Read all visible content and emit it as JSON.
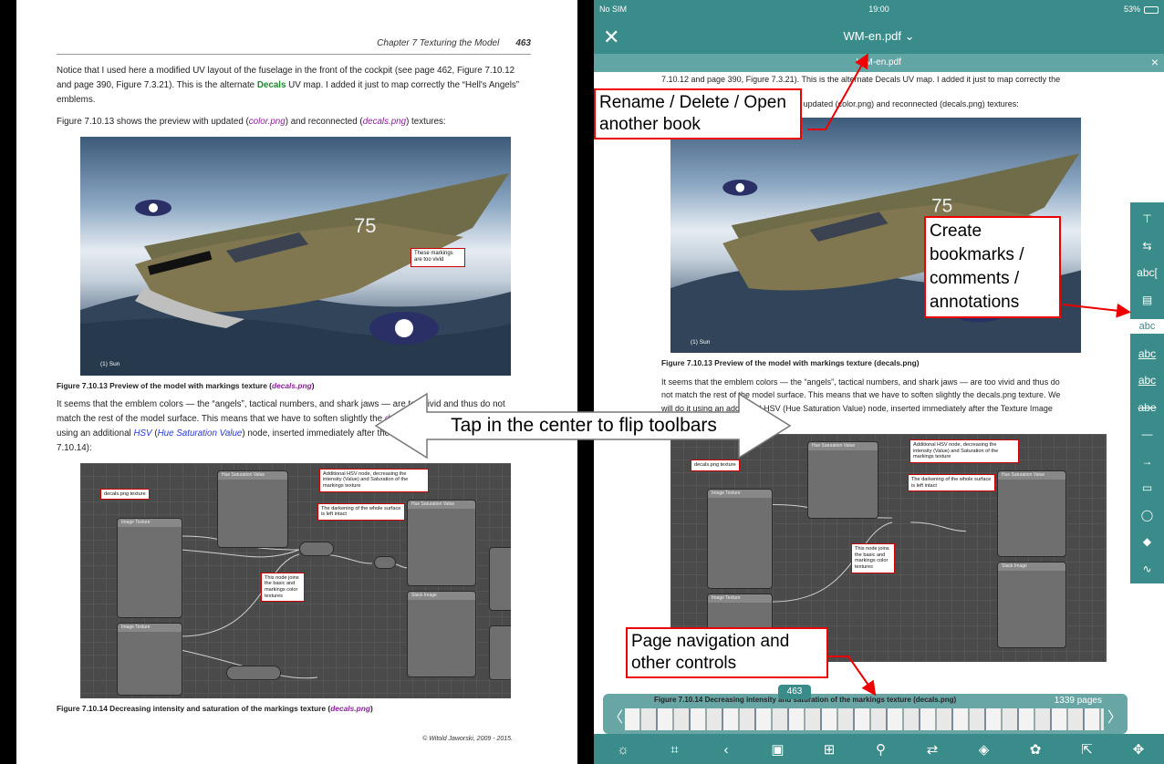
{
  "left_page": {
    "chapter": "Chapter 7 Texturing the Model",
    "page_number": "463",
    "para1_a": "Notice that I used here a modified UV layout of the fuselage in the front of the cockpit (see page 462, Figure 7.10.12 and page 390, Figure 7.3.21). This is the alternate ",
    "para1_decals": "Decals",
    "para1_b": " UV map. I added it just to map correctly the “Hell's Angels” emblems.",
    "para2_a": "Figure 7.10.13 shows the preview with updated (",
    "para2_color": "color.png",
    "para2_b": ") and reconnected (",
    "para2_decals": "decals.png",
    "para2_c": ") textures:",
    "photo_note": "These markings are too vivid",
    "sun_label": "(1) Sun",
    "caption1_a": "Figure 7.10.13 Preview of the model with markings texture (",
    "caption1_file": "decals.png",
    "caption1_b": ")",
    "para3_a": "It seems that the emblem colors — the “angels”, tactical numbers, and shark jaws — are too vivid and thus do not match the rest of the model surface. This means that we have to soften slightly the ",
    "para3_file": "decals.png",
    "para3_b": " texture. We will do it using an additional ",
    "para3_hsv": "HSV",
    "para3_c": " (",
    "para3_hsvfull": "Hue Saturation Value",
    "para3_d": ") node, inserted immediately after the ",
    "para3_tex": "Texture Image",
    "para3_e": " node (Figure 7.10.14):",
    "caption2_a": "Figure 7.10.14 Decreasing intensity and saturation of the markings texture (",
    "caption2_file": "decals.png",
    "caption2_b": ")",
    "footer": "© Witold Jaworski, 2009 - 2015."
  },
  "node_labels": {
    "decals_texture": "decals.png texture",
    "hsv_note": "Additional HSV node, decreasing the intensity (Value) and Saturation of the markings texture",
    "darkening_note": "The darkening of the whole surface is left intact",
    "joins_note": "This node joins the basic and markings color textures"
  },
  "ipad": {
    "carrier": "No SIM",
    "time": "19:00",
    "battery": "53%",
    "doc_title": "WM-en.pdf ⌄",
    "tab_title": "WM-en.pdf",
    "text_top": "7.10.12 and page 390, Figure 7.3.21). This is the alternate Decals UV map. I added it just to map correctly the",
    "text_preview": "Figure 7.10.13 shows the preview with updated (color.png) and reconnected (decals.png) textures:",
    "caption1": "Figure 7.10.13 Preview of the model with markings texture (decals.png)",
    "text_lines": [
      "It seems that the emblem colors — the “angels”, tactical numbers, and shark jaws — are too vivid and thus do",
      "not match the rest of the model surface. This means that we have to soften slightly the decals.png texture. We",
      "will do it using an additional HSV (Hue Saturation Value) node, inserted immediately after the Texture Image",
      "node (Figure 7.10.14):"
    ],
    "caption2": "Figure 7.10.14 Decreasing intensity and saturation of the markings texture (decals.png)",
    "current_page": "463",
    "page_count": "1339 pages",
    "sidebar_icons": [
      "pin-icon",
      "pages-icon",
      "text-select-icon",
      "comment-icon",
      "highlight-icon",
      "underline-icon",
      "squiggly-icon",
      "strikeout-icon",
      "line-icon",
      "arrow-icon",
      "rectangle-icon",
      "ellipse-icon",
      "eraser-icon",
      "freehand-icon"
    ],
    "sidebar_glyphs": [
      "⊤",
      "⇆",
      "abc[",
      "▤",
      "abc",
      "abc",
      "abc",
      "abe",
      "—",
      "→",
      "▭",
      "◯",
      "◆",
      "∿"
    ],
    "bottom_icons": [
      "brightness-icon",
      "crop-icon",
      "back-icon",
      "book-icon",
      "grid-icon",
      "search-icon",
      "convert-icon",
      "night-mode-icon",
      "settings-icon",
      "export-icon",
      "toolbar-toggle-icon"
    ],
    "bottom_glyphs": [
      "☼",
      "⌗",
      "‹",
      "▣",
      "⊞",
      "⚲",
      "⇄",
      "◈",
      "✿",
      "⇱",
      "✥"
    ]
  },
  "callouts": {
    "rename": "Rename / Delete / Open another book",
    "bookmarks": "Create bookmarks / comments / annotations",
    "center": "Tap in the center to flip toolbars",
    "nav": "Page navigation and other controls"
  },
  "colors": {
    "teal": "#3a8c8b",
    "callout_border": "#e00000"
  }
}
